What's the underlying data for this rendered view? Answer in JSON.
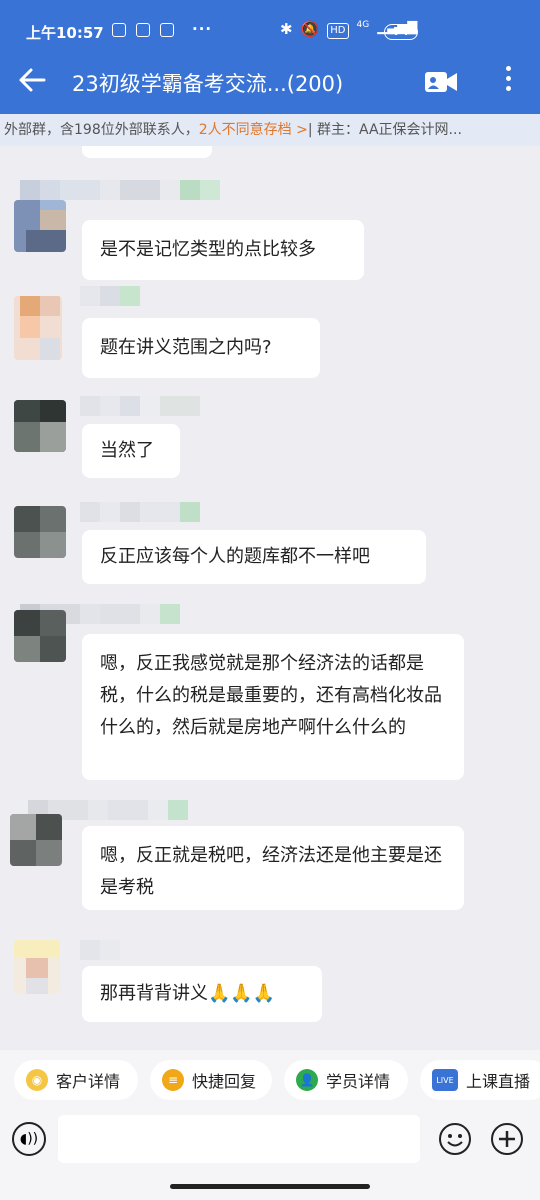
{
  "status_bar": {
    "time": "上午10:57",
    "battery": "74",
    "network": "4G",
    "hd": "HD"
  },
  "header": {
    "title": "23初级学霸备考交流...(200)"
  },
  "banner": {
    "prefix": "外部群，含198位外部联系人，",
    "warning": "2人不同意存档 >",
    "owner": "| 群主：AA正保会计网..."
  },
  "messages": [
    {
      "text": "是不是记忆类型的点比较多"
    },
    {
      "text": "题在讲义范围之内吗?"
    },
    {
      "text": "当然了"
    },
    {
      "text": "反正应该每个人的题库都不一样吧"
    },
    {
      "text": "嗯，反正我感觉就是那个经济法的话都是税，什么的税是最重要的，还有高档化妆品什么的，然后就是房地产啊什么什么的"
    },
    {
      "text": "嗯，反正就是税吧，经济法还是他主要是还是考税"
    },
    {
      "text": "那再背背讲义🙏🙏🙏"
    }
  ],
  "quick_actions": [
    {
      "label": "客户详情",
      "icon": "customer-icon",
      "color": "#f5c544"
    },
    {
      "label": "快捷回复",
      "icon": "quick-reply-icon",
      "color": "#f0a818"
    },
    {
      "label": "学员详情",
      "icon": "student-icon",
      "color": "#2eaa4e"
    },
    {
      "label": "上课直播",
      "icon": "live-icon",
      "color": "#3a73d6",
      "badge": "LIVE"
    }
  ]
}
